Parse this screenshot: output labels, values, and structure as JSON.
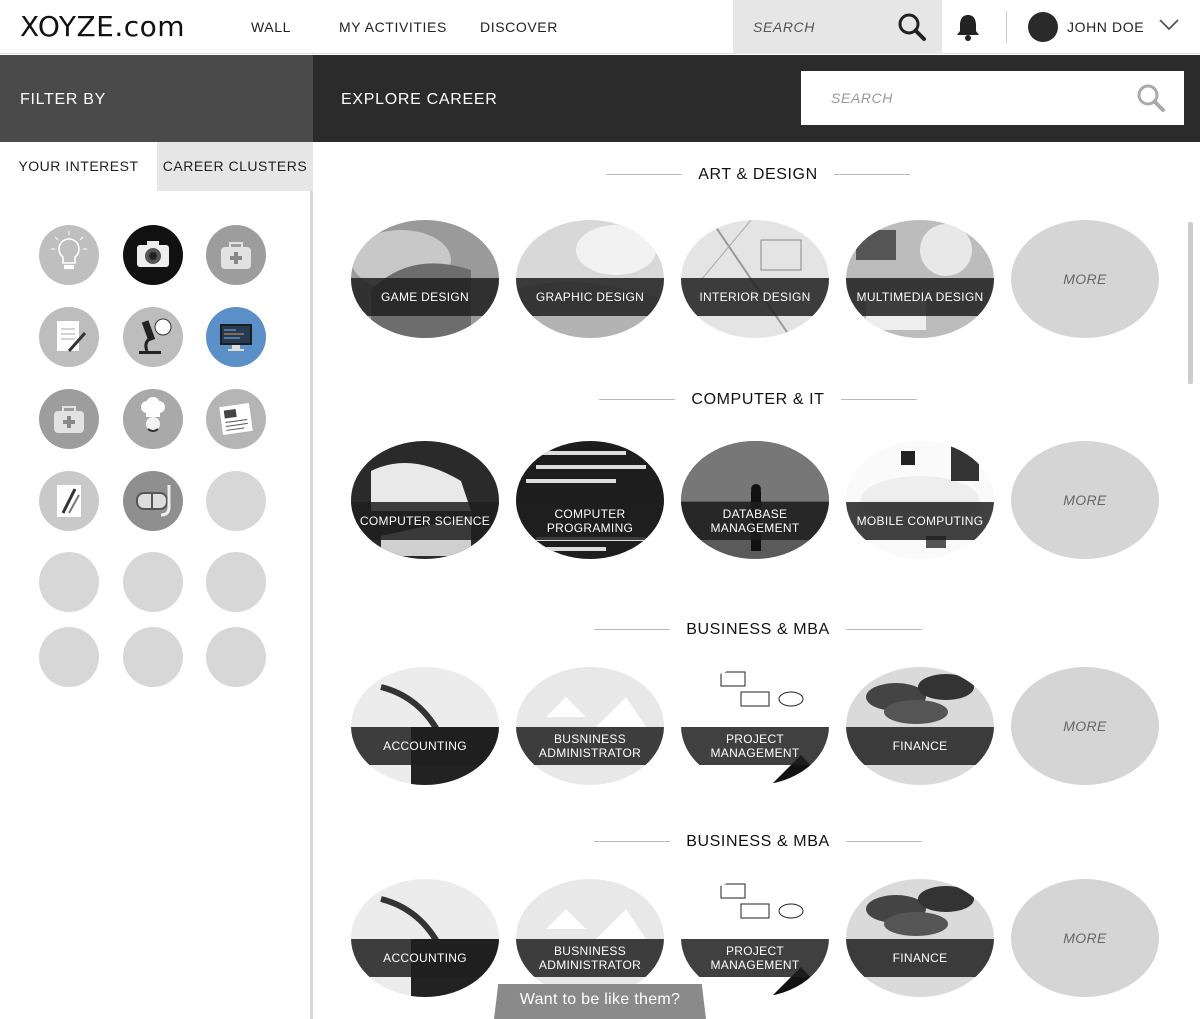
{
  "brand": "XOYZE.com",
  "nav": {
    "wall": "WALL",
    "activities": "MY ACTIVITIES",
    "discover": "DISCOVER"
  },
  "top_search": {
    "placeholder": "SEARCH"
  },
  "user": {
    "name": "JOHN DOE"
  },
  "filter": {
    "title": "FILTER BY"
  },
  "explore": {
    "title": "EXPLORE CAREER",
    "search_placeholder": "SEARCH"
  },
  "tabs": {
    "interest": "YOUR INTEREST",
    "clusters": "CAREER CLUSTERS"
  },
  "sidebar_icons": [
    "lightbulb-icon",
    "camera-icon",
    "medical-kit-icon",
    "notepad-icon",
    "microscope-icon",
    "computer-icon",
    "medical-kit-icon",
    "chef-icon",
    "newspaper-icon",
    "drawing-tools-icon",
    "diving-mask-icon",
    "empty-icon",
    "empty-icon",
    "empty-icon",
    "empty-icon",
    "empty-icon",
    "empty-icon",
    "empty-icon"
  ],
  "sections": [
    {
      "title": "ART & DESIGN",
      "cards": [
        "GAME DESIGN",
        "GRAPHIC DESIGN",
        "INTERIOR DESIGN",
        "MULTIMEDIA DESIGN"
      ],
      "more": "MORE"
    },
    {
      "title": "COMPUTER & IT",
      "cards": [
        "COMPUTER SCIENCE",
        "COMPUTER PROGRAMING",
        "DATABASE MANAGEMENT",
        "MOBILE COMPUTING"
      ],
      "more": "MORE"
    },
    {
      "title": "BUSINESS & MBA",
      "cards": [
        "ACCOUNTING",
        "BUSNINESS ADMINISTRATOR",
        "PROJECT MANAGEMENT",
        "FINANCE"
      ],
      "more": "MORE"
    },
    {
      "title": "BUSINESS & MBA",
      "cards": [
        "ACCOUNTING",
        "BUSNINESS ADMINISTRATOR",
        "PROJECT MANAGEMENT",
        "FINANCE"
      ],
      "more": "MORE"
    }
  ],
  "cta": "Want to be like them?",
  "colors": {
    "dark_header": "#2b2b2b",
    "filter_header": "#4a4a4a",
    "accent_blue": "#5b8fc7",
    "placeholder_gray": "#d7d7d7"
  }
}
